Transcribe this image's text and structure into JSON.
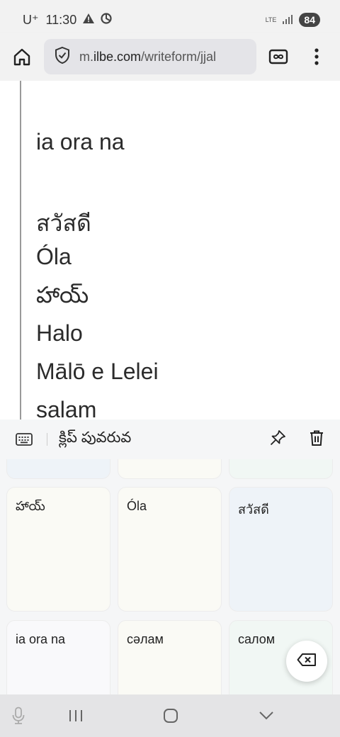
{
  "status": {
    "carrier": "U⁺",
    "time": "11:30",
    "network": "LTE",
    "battery": "84",
    "icons": [
      "alert-icon",
      "sync-icon",
      "signal-icon"
    ]
  },
  "browser": {
    "url_domain_prefix": "m.",
    "url_domain": "ilbe.com",
    "url_path": "/writeform/jjal",
    "icons": [
      "home-icon",
      "shield-check-icon",
      "tabs-icon",
      "more-vert-icon"
    ]
  },
  "page": {
    "lines": [
      "ia ora na",
      "สวัสดี",
      "Óla",
      "హాయ్",
      "Halo",
      "Mālō e Lelei",
      "salam"
    ]
  },
  "clipboard": {
    "title": "క్లిప్ పువరువ",
    "cards": [
      {
        "text": "హాయ్"
      },
      {
        "text": "Óla"
      },
      {
        "text": "สวัสดี"
      },
      {
        "text": "ia ora na"
      },
      {
        "text": "сәлам"
      },
      {
        "text": "салом"
      }
    ],
    "icons": [
      "keyboard-icon",
      "pin-icon",
      "delete-icon",
      "backspace-icon"
    ]
  },
  "navbar": {
    "icons": [
      "mic-icon",
      "recents-icon",
      "home-nav-icon",
      "collapse-icon"
    ]
  }
}
